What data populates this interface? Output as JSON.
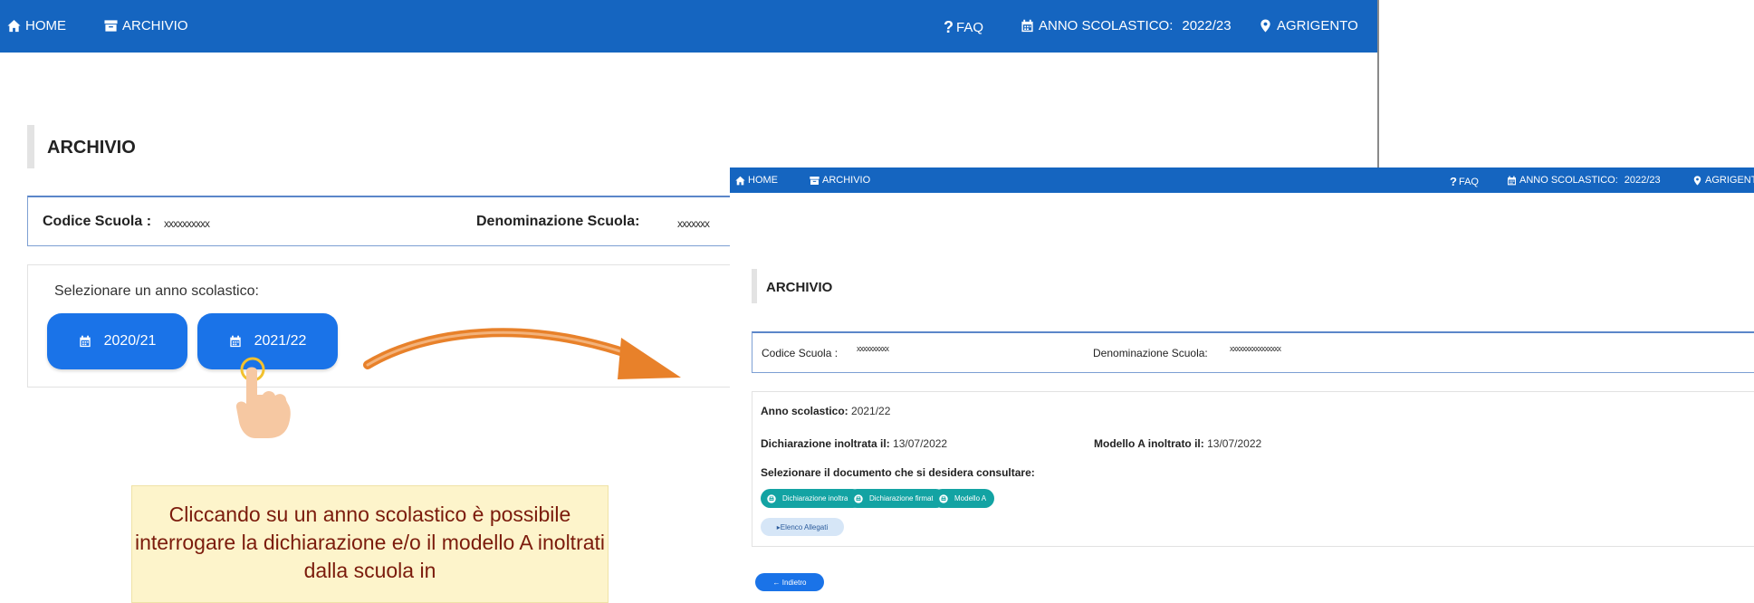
{
  "screen1": {
    "navbar": {
      "home": "HOME",
      "archive": "ARCHIVIO",
      "faq": "FAQ",
      "school_year_label": "ANNO SCOLASTICO:",
      "school_year_value": "2022/23",
      "location": "AGRIGENTO"
    },
    "page_title": "ARCHIVIO",
    "school_info": {
      "code_label": "Codice Scuola :",
      "code_value": "xxxxxxxxxx",
      "name_label": "Denominazione Scuola:",
      "name_value": "xxxxxxx"
    },
    "year_prompt": "Selezionare un anno scolastico:",
    "year_buttons": [
      "2020/21",
      "2021/22"
    ]
  },
  "screen2": {
    "navbar": {
      "home": "HOME",
      "archive": "ARCHIVIO",
      "faq": "FAQ",
      "school_year_label": "ANNO SCOLASTICO:",
      "school_year_value": "2022/23",
      "location": "AGRIGENT"
    },
    "page_title": "ARCHIVIO",
    "school_info": {
      "code_label": "Codice Scuola :",
      "code_value": "xxxxxxxxxx",
      "name_label": "Denominazione Scuola:",
      "name_value": "xxxxxxxxxxxxxxxx"
    },
    "details": {
      "school_year_label": "Anno scolastico:",
      "school_year_value": "2021/22",
      "declaration_label": "Dichiarazione inoltrata il:",
      "declaration_date": "13/07/2022",
      "model_label": "Modello A inoltrato il:",
      "model_date": "13/07/2022",
      "select_prompt": "Selezionare il documento che si desidera consultare:"
    },
    "doc_buttons": [
      "Dichiarazione inoltrata",
      "Dichiarazione firmata",
      "Modello A"
    ],
    "attachments_button": "▸Elenco Allegati",
    "back_button": "← Indietro"
  },
  "callout_text": "Cliccando su un anno scolastico è possibile interrogare la dichiarazione e/o il modello A inoltrati dalla scuola in",
  "colors": {
    "navbar": "#1565c0",
    "year_button": "#1a73e8",
    "doc_button": "#13a3a3",
    "arrow": "#e8812a",
    "callout_bg": "#fdf4cb",
    "callout_text": "#7b1b0c"
  },
  "icons": [
    "home-icon",
    "archive-icon",
    "question-icon",
    "calendar-icon",
    "map-pin-icon",
    "print-icon",
    "pointing-hand-icon",
    "curved-arrow-icon"
  ]
}
